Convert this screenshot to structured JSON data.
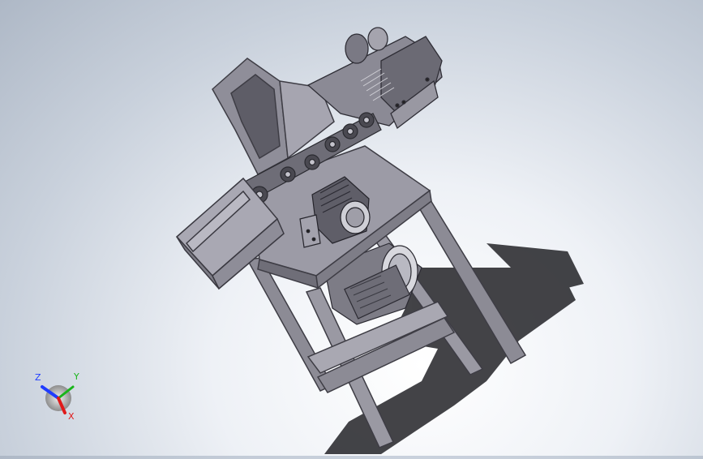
{
  "viewport": {
    "background_top": "#aeb8c6",
    "background_bottom": "#ffffff",
    "model_color": "#8c8b95",
    "model_dark": "#5f5e68",
    "model_light": "#b4b3bd",
    "shadow_color": "#2f2f33"
  },
  "triad": {
    "z_label": "Z",
    "y_label": "Y",
    "x_label": "X",
    "z_color": "#1f3cff",
    "y_color": "#19b51a",
    "x_color": "#e01a1a"
  }
}
